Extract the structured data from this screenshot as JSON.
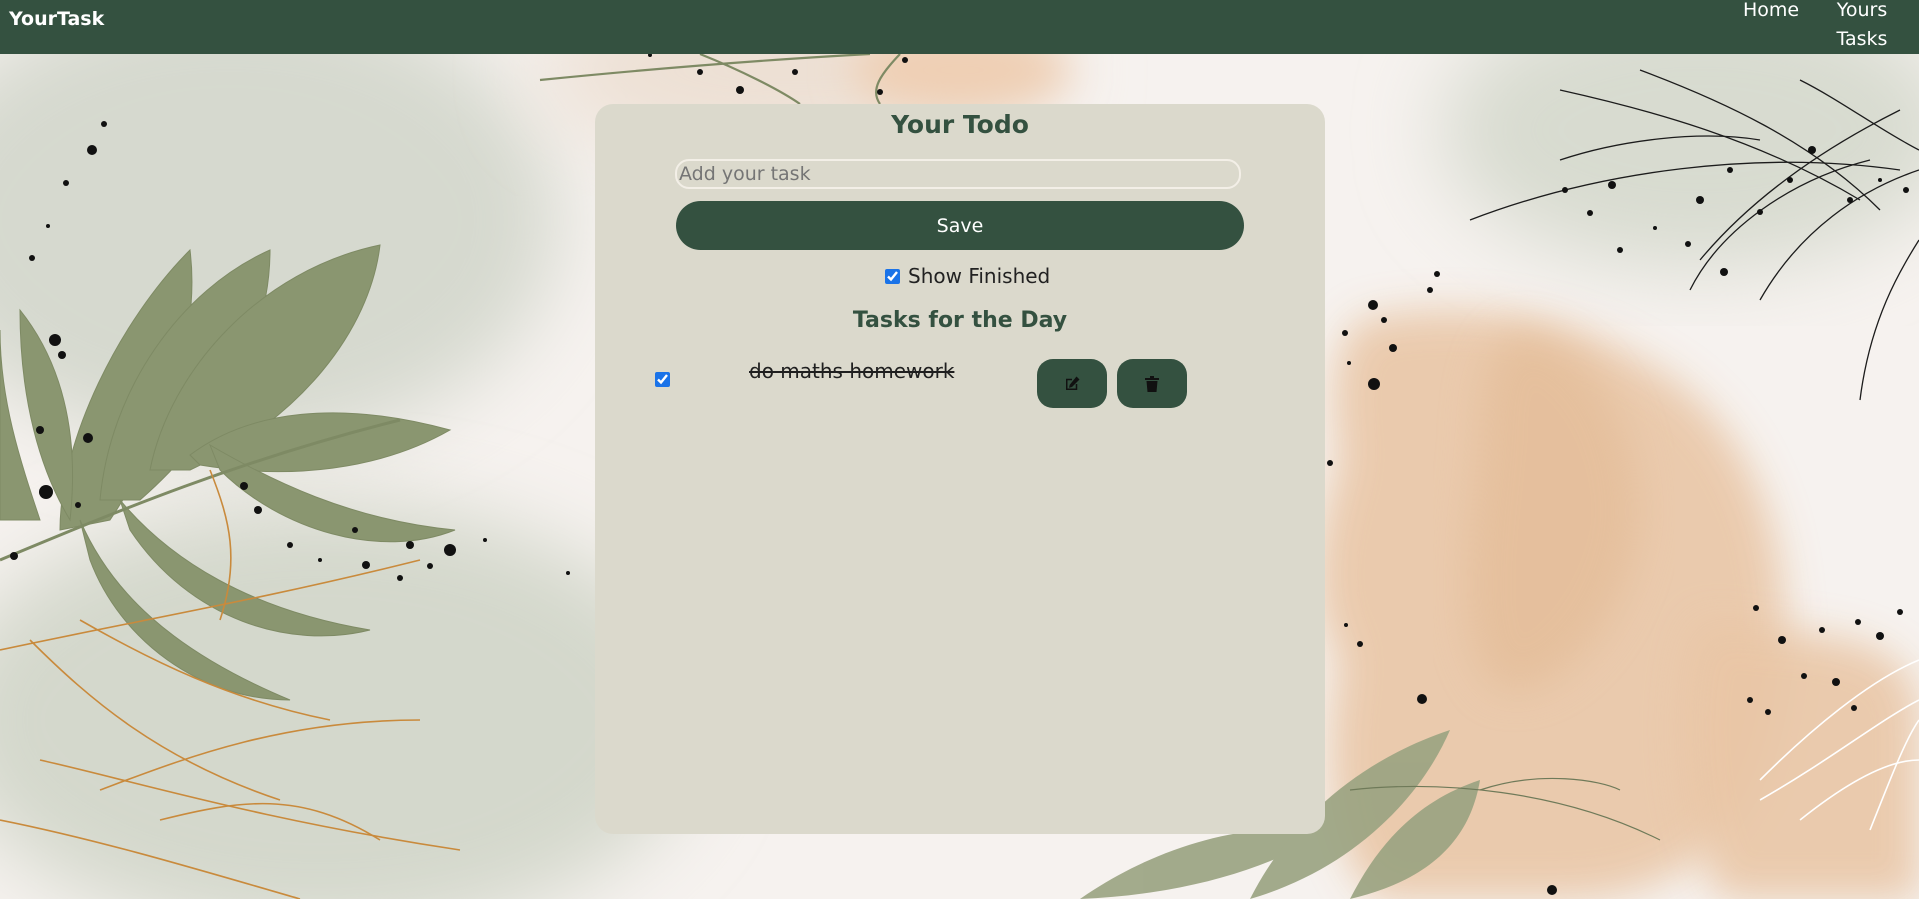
{
  "app": {
    "brand": "YourTask"
  },
  "nav": {
    "home": "Home",
    "tasks": "Yours Tasks"
  },
  "todo": {
    "title": "Your Todo",
    "input_placeholder": "Add your task",
    "input_value": "",
    "save_label": "Save",
    "show_finished_label": "Show Finished",
    "show_finished_checked": true,
    "section_title": "Tasks for the Day"
  },
  "tasks": [
    {
      "text": "do maths homework",
      "done": true,
      "edit_icon": "edit-icon",
      "delete_icon": "trash-icon"
    }
  ],
  "colors": {
    "primary": "#345140",
    "card": "#dbd9cc",
    "page_bg": "#f6f2ef",
    "leaf_green": "#8a9670",
    "peach": "#e8c2a0",
    "copper_line": "#c98a3c"
  }
}
